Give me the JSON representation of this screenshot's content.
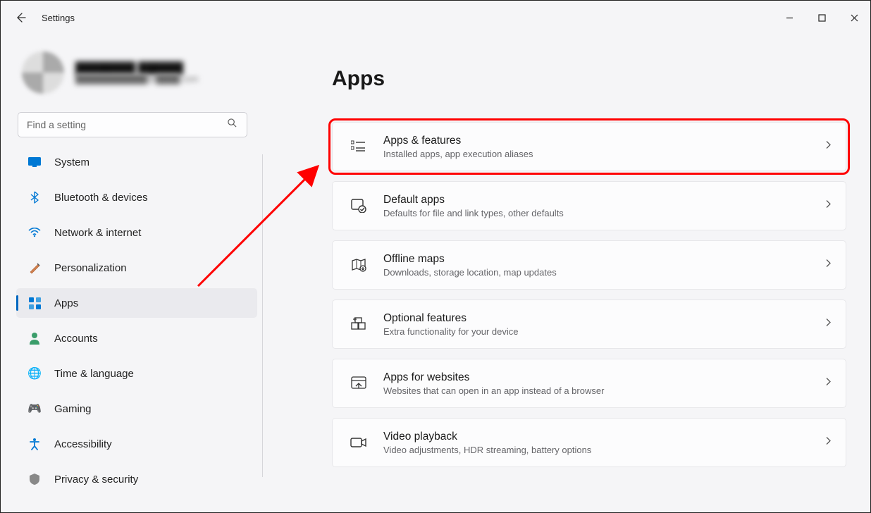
{
  "window": {
    "title": "Settings"
  },
  "user": {
    "name": "████████ ██████",
    "email": "████████████@████.com"
  },
  "search": {
    "placeholder": "Find a setting"
  },
  "sidebar": {
    "items": [
      {
        "label": "System",
        "icon": "🖥️"
      },
      {
        "label": "Bluetooth & devices",
        "icon": "bt"
      },
      {
        "label": "Network & internet",
        "icon": "📶"
      },
      {
        "label": "Personalization",
        "icon": "🖌️"
      },
      {
        "label": "Apps",
        "icon": "apps",
        "selected": true
      },
      {
        "label": "Accounts",
        "icon": "👤"
      },
      {
        "label": "Time & language",
        "icon": "🌐"
      },
      {
        "label": "Gaming",
        "icon": "🎮"
      },
      {
        "label": "Accessibility",
        "icon": "acc"
      },
      {
        "label": "Privacy & security",
        "icon": "🛡️"
      }
    ]
  },
  "page": {
    "title": "Apps"
  },
  "cards": [
    {
      "title": "Apps & features",
      "desc": "Installed apps, app execution aliases",
      "highlight": true
    },
    {
      "title": "Default apps",
      "desc": "Defaults for file and link types, other defaults"
    },
    {
      "title": "Offline maps",
      "desc": "Downloads, storage location, map updates"
    },
    {
      "title": "Optional features",
      "desc": "Extra functionality for your device"
    },
    {
      "title": "Apps for websites",
      "desc": "Websites that can open in an app instead of a browser"
    },
    {
      "title": "Video playback",
      "desc": "Video adjustments, HDR streaming, battery options"
    }
  ]
}
